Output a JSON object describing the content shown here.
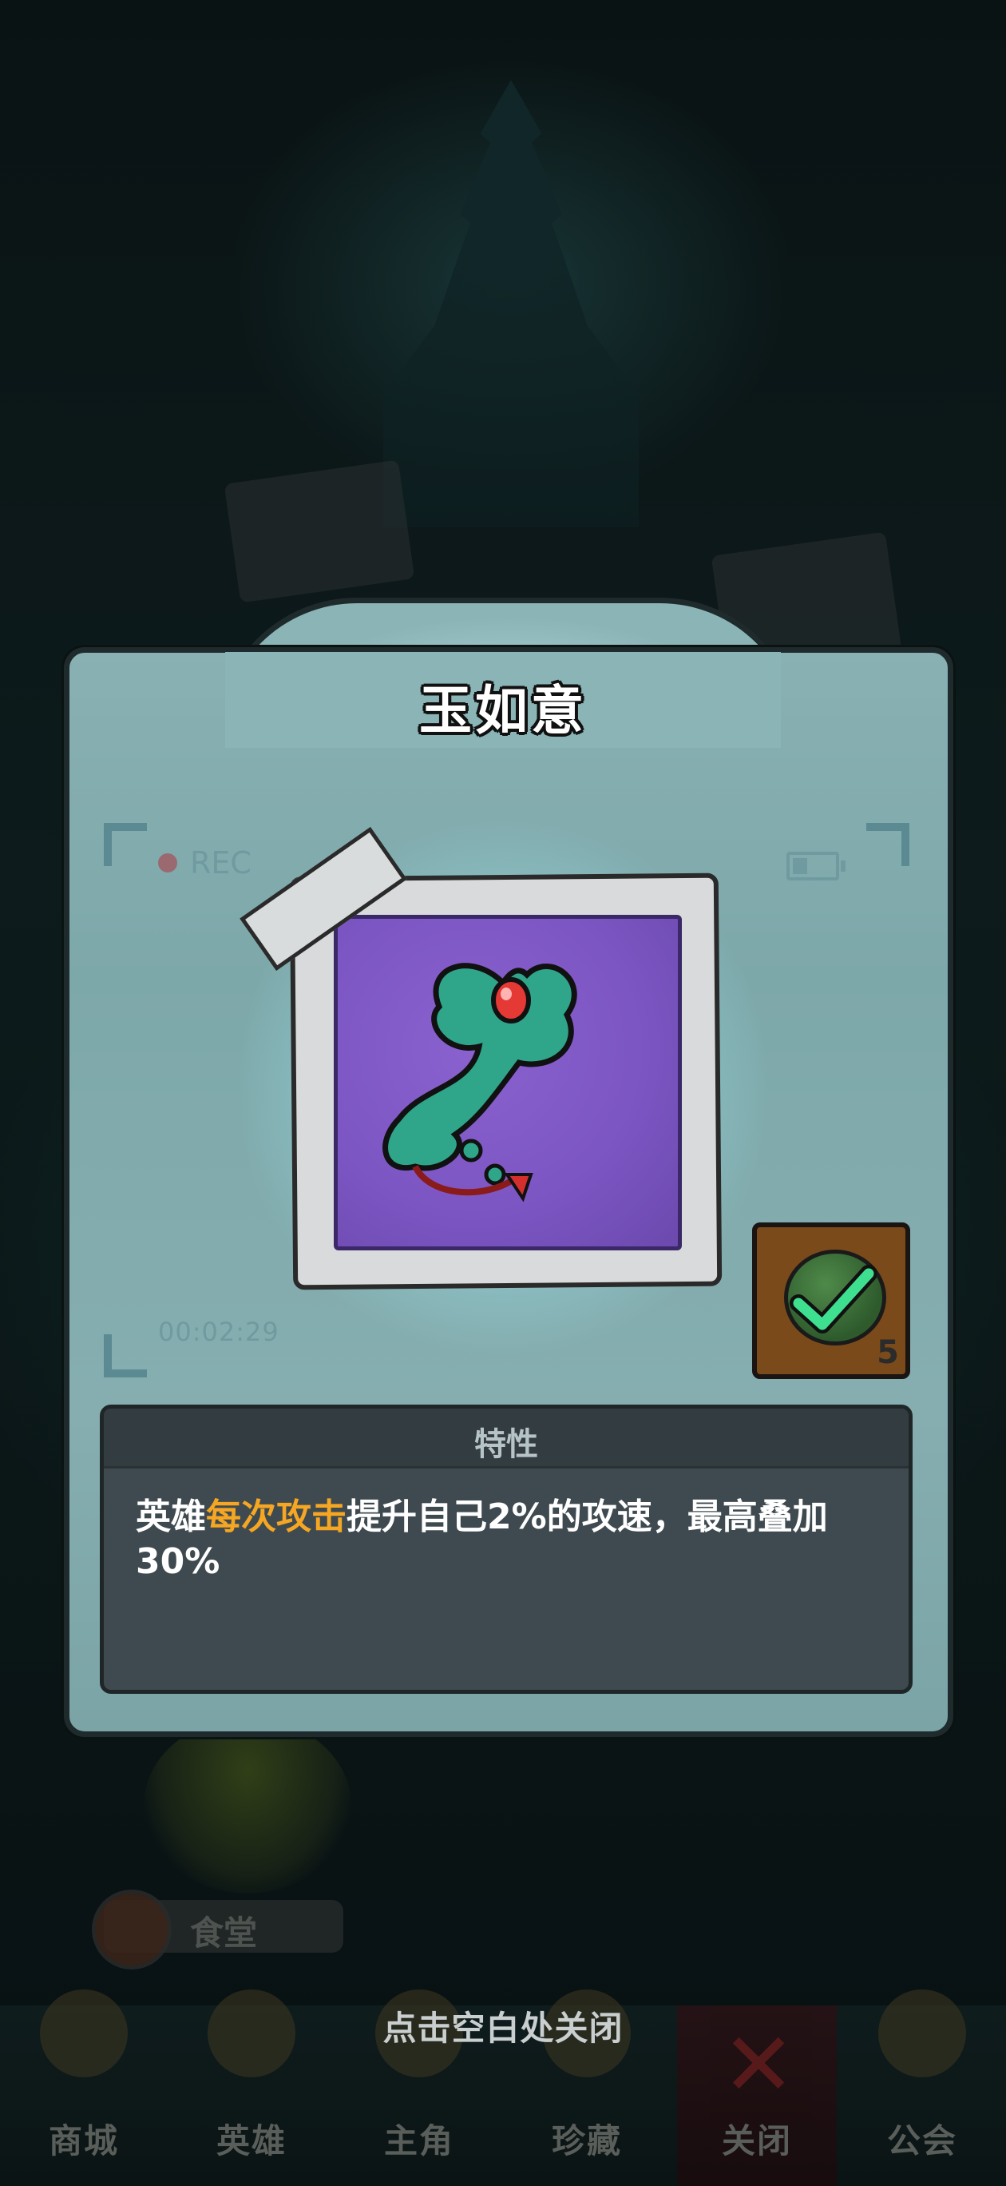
{
  "modal": {
    "title": "玉如意",
    "camera": {
      "rec_label": "REC",
      "timecode": "00:02:29"
    },
    "badge": {
      "count": "5"
    },
    "traits": {
      "header": "特性",
      "desc_prefix": "英雄",
      "desc_highlight": "每次攻击",
      "desc_suffix": "提升自己2%的攻速，最高叠加30%"
    },
    "highlight_color": "#f5a623",
    "close_hint": "点击空白处关闭"
  },
  "background": {
    "canteen_label": "食堂"
  },
  "bottom_nav": {
    "items": [
      {
        "label": "商城"
      },
      {
        "label": "英雄"
      },
      {
        "label": "主角"
      },
      {
        "label": "珍藏"
      },
      {
        "label": "关闭"
      },
      {
        "label": "公会"
      }
    ]
  }
}
